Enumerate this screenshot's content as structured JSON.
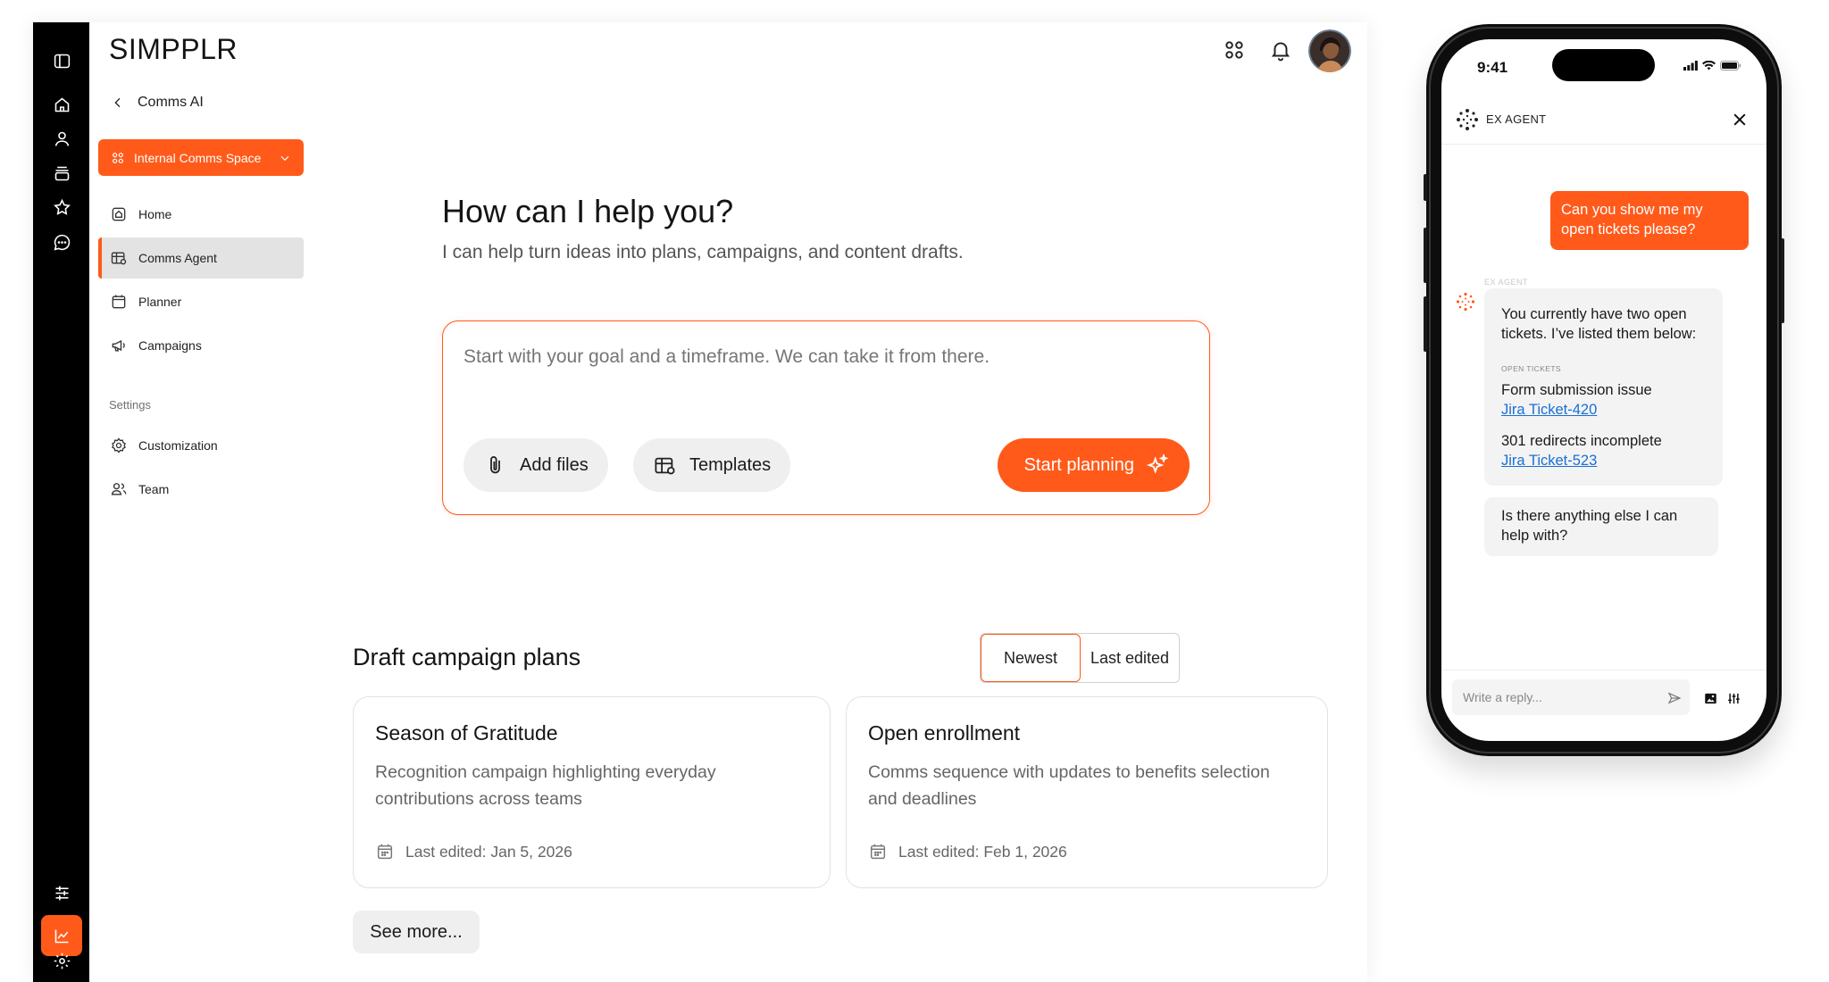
{
  "app": {
    "logo": "SIMPPLR"
  },
  "sidebar": {
    "back_label": "Comms AI",
    "space_select": "Internal Comms Space",
    "items": [
      {
        "label": "Home",
        "icon": "home-icon"
      },
      {
        "label": "Comms Agent",
        "icon": "table-icon",
        "active": true
      },
      {
        "label": "Planner",
        "icon": "calendar-icon"
      },
      {
        "label": "Campaigns",
        "icon": "megaphone-icon"
      }
    ],
    "settings_label": "Settings",
    "settings_items": [
      {
        "label": "Customization",
        "icon": "gear-icon"
      },
      {
        "label": "Team",
        "icon": "users-icon"
      }
    ]
  },
  "main": {
    "title": "How can I help you?",
    "subtitle": "I can help turn ideas into plans, campaigns, and content drafts.",
    "prompt_placeholder": "Start with your goal and a timeframe. We can take it from there.",
    "add_files": "Add files",
    "templates": "Templates",
    "start_planning": "Start planning",
    "drafts_title": "Draft campaign plans",
    "sort": {
      "newest": "Newest",
      "last_edited": "Last edited",
      "selected": "Newest"
    },
    "cards": [
      {
        "title": "Season of Gratitude",
        "desc": "Recognition campaign highlighting everyday contributions across teams",
        "date": "Last edited: Jan 5, 2026"
      },
      {
        "title": "Open enrollment",
        "desc": "Comms sequence with updates to benefits selection and deadlines",
        "date": "Last edited: Feb 1, 2026"
      }
    ],
    "see_more": "See more..."
  },
  "phone": {
    "time": "9:41",
    "agent_title": "EX AGENT",
    "user_message": "Can you show me my open tickets please?",
    "agent_label": "EX AGENT",
    "agent_reply_intro": "You currently have two open tickets. I’ve listed them below:",
    "tickets_label": "OPEN TICKETS",
    "tickets": [
      {
        "title": "Form submission issue",
        "link": "Jira Ticket-420"
      },
      {
        "title": "301 redirects incomplete",
        "link": "Jira Ticket-523"
      }
    ],
    "agent_followup": "Is there anything else I can help with?",
    "reply_placeholder": "Write a reply..."
  },
  "colors": {
    "accent": "#ff5a1a",
    "rail": "#000000",
    "link": "#1a6fd4"
  }
}
